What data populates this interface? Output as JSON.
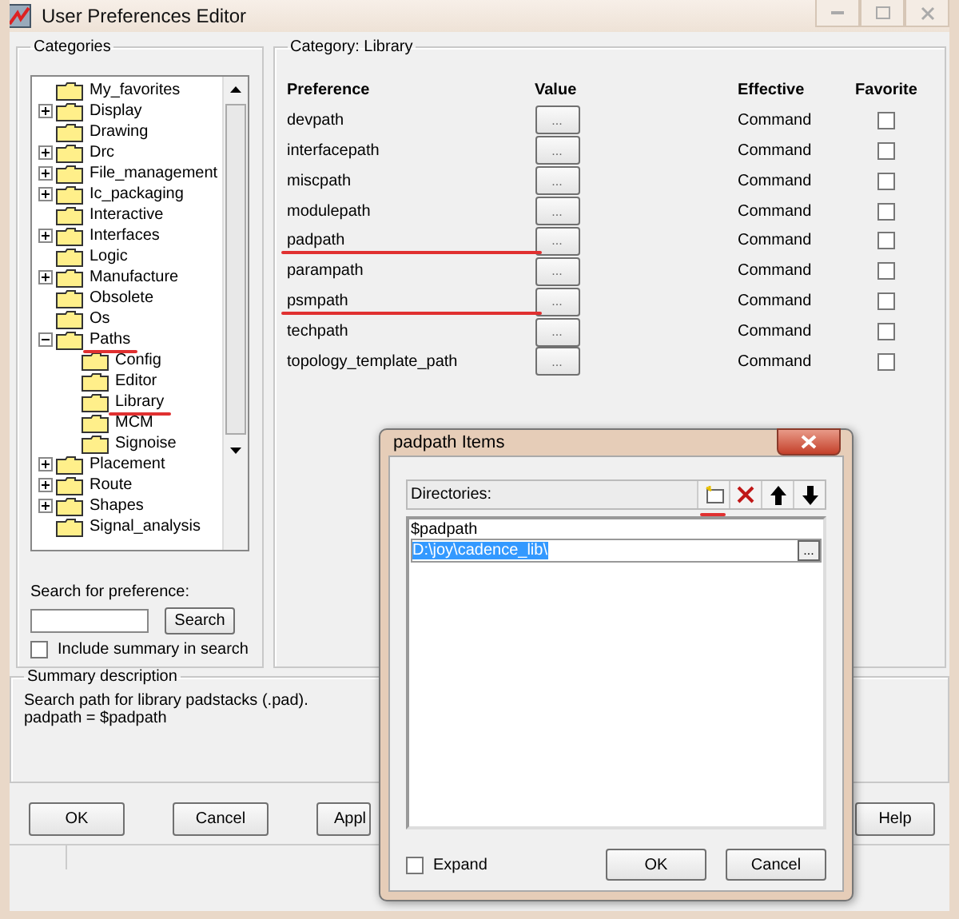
{
  "window": {
    "title": "User Preferences Editor"
  },
  "categories": {
    "title": "Categories",
    "tree": [
      {
        "label": "My_favorites",
        "expandable": false,
        "underlined": false
      },
      {
        "label": "Display",
        "expandable": true,
        "expanded": false,
        "underlined": false
      },
      {
        "label": "Drawing",
        "expandable": false,
        "underlined": false
      },
      {
        "label": "Drc",
        "expandable": true,
        "expanded": false,
        "underlined": false
      },
      {
        "label": "File_management",
        "expandable": true,
        "expanded": false,
        "underlined": false
      },
      {
        "label": "Ic_packaging",
        "expandable": true,
        "expanded": false,
        "underlined": false
      },
      {
        "label": "Interactive",
        "expandable": false,
        "underlined": false
      },
      {
        "label": "Interfaces",
        "expandable": true,
        "expanded": false,
        "underlined": false
      },
      {
        "label": "Logic",
        "expandable": false,
        "underlined": false
      },
      {
        "label": "Manufacture",
        "expandable": true,
        "expanded": false,
        "underlined": false
      },
      {
        "label": "Obsolete",
        "expandable": false,
        "underlined": false
      },
      {
        "label": "Os",
        "expandable": false,
        "underlined": false
      },
      {
        "label": "Paths",
        "expandable": true,
        "expanded": true,
        "underlined": true,
        "children": [
          {
            "label": "Config",
            "expandable": false,
            "underlined": false
          },
          {
            "label": "Editor",
            "expandable": false,
            "underlined": false
          },
          {
            "label": "Library",
            "expandable": false,
            "underlined": true
          },
          {
            "label": "MCM",
            "expandable": false,
            "underlined": false
          },
          {
            "label": "Signoise",
            "expandable": false,
            "underlined": false
          }
        ]
      },
      {
        "label": "Placement",
        "expandable": true,
        "expanded": false,
        "underlined": false
      },
      {
        "label": "Route",
        "expandable": true,
        "expanded": false,
        "underlined": false
      },
      {
        "label": "Shapes",
        "expandable": true,
        "expanded": false,
        "underlined": false
      },
      {
        "label": "Signal_analysis",
        "expandable": false,
        "underlined": false
      }
    ],
    "search_label": "Search for preference:",
    "search_button": "Search",
    "include_summary": {
      "label": "Include summary in search",
      "checked": false
    }
  },
  "category": {
    "title": "Category:",
    "name": "Library",
    "columns": [
      "Preference",
      "Value",
      "Effective",
      "Favorite"
    ],
    "rows": [
      {
        "preference": "devpath",
        "value": "...",
        "effective": "Command",
        "favorite": false,
        "underlined": false
      },
      {
        "preference": "interfacepath",
        "value": "...",
        "effective": "Command",
        "favorite": false,
        "underlined": false
      },
      {
        "preference": "miscpath",
        "value": "...",
        "effective": "Command",
        "favorite": false,
        "underlined": false
      },
      {
        "preference": "modulepath",
        "value": "...",
        "effective": "Command",
        "favorite": false,
        "underlined": false
      },
      {
        "preference": "padpath",
        "value": "...",
        "effective": "Command",
        "favorite": false,
        "underlined": true
      },
      {
        "preference": "parampath",
        "value": "...",
        "effective": "Command",
        "favorite": false,
        "underlined": false
      },
      {
        "preference": "psmpath",
        "value": "...",
        "effective": "Command",
        "favorite": false,
        "underlined": true
      },
      {
        "preference": "techpath",
        "value": "...",
        "effective": "Command",
        "favorite": false,
        "underlined": false
      },
      {
        "preference": "topology_template_path",
        "value": "...",
        "effective": "Command",
        "favorite": false,
        "underlined": false
      }
    ]
  },
  "summary": {
    "title": "Summary description",
    "lines": [
      "Search path for library padstacks (.pad).",
      "padpath = $padpath"
    ]
  },
  "buttons": [
    "OK",
    "Cancel",
    "Appl",
    "Help"
  ],
  "dialog": {
    "title": "padpath Items",
    "directories_label": "Directories:",
    "toolbar": [
      {
        "kind": "new",
        "underlined": true
      },
      {
        "kind": "delete",
        "underlined": false
      },
      {
        "kind": "up",
        "underlined": false
      },
      {
        "kind": "down",
        "underlined": false
      }
    ],
    "items": [
      {
        "text": "$padpath",
        "selected": false,
        "editing": false
      },
      {
        "text": "D:\\joy\\cadence_lib\\",
        "selected": true,
        "editing": true,
        "browse": "..."
      }
    ],
    "expand": {
      "label": "Expand",
      "checked": false
    },
    "buttons": [
      "OK",
      "Cancel"
    ]
  }
}
